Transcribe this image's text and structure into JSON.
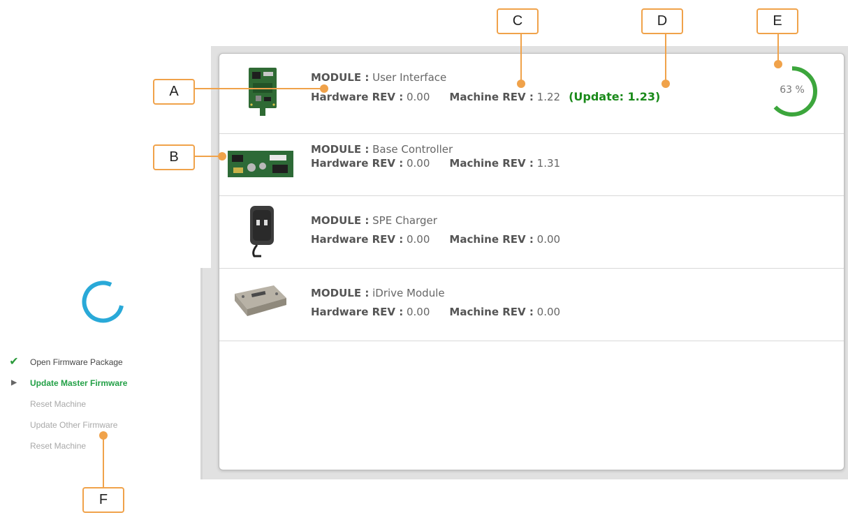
{
  "modules": [
    {
      "module_label": "MODULE :",
      "module_name": "User Interface",
      "hw_label": "Hardware REV :",
      "hw_value": "0.00",
      "machine_label": "Machine REV :",
      "machine_value": "1.22",
      "update_note": "(Update: 1.23)",
      "progress_text": "63 %",
      "progress_fraction": 0.63
    },
    {
      "module_label": "MODULE :",
      "module_name": "Base Controller",
      "hw_label": "Hardware REV :",
      "hw_value": "0.00",
      "machine_label": "Machine REV :",
      "machine_value": "1.31"
    },
    {
      "module_label": "MODULE :",
      "module_name": "SPE Charger",
      "hw_label": "Hardware REV :",
      "hw_value": "0.00",
      "machine_label": "Machine REV :",
      "machine_value": "0.00"
    },
    {
      "module_label": "MODULE :",
      "module_name": "iDrive Module",
      "hw_label": "Hardware REV :",
      "hw_value": "0.00",
      "machine_label": "Machine REV :",
      "machine_value": "0.00"
    }
  ],
  "steps": [
    {
      "label": "Open Firmware Package",
      "status": "done"
    },
    {
      "label": "Update Master Firmware",
      "status": "active"
    },
    {
      "label": "Reset Machine",
      "status": "pending"
    },
    {
      "label": "Update Other Firmware",
      "status": "pending"
    },
    {
      "label": "Reset Machine",
      "status": "pending"
    }
  ],
  "callouts": {
    "a": "A",
    "b": "B",
    "c": "C",
    "d": "D",
    "e": "E",
    "f": "F"
  },
  "icons": {
    "step_done": "checkmark-icon",
    "step_active": "play-arrow-icon",
    "loading": "spinner-icon"
  },
  "colors": {
    "callout": "#f0a24a",
    "progress": "#3ca63c",
    "update_text": "#1a8a1a",
    "active_step": "#22a046",
    "spinner": "#29a9d8"
  }
}
